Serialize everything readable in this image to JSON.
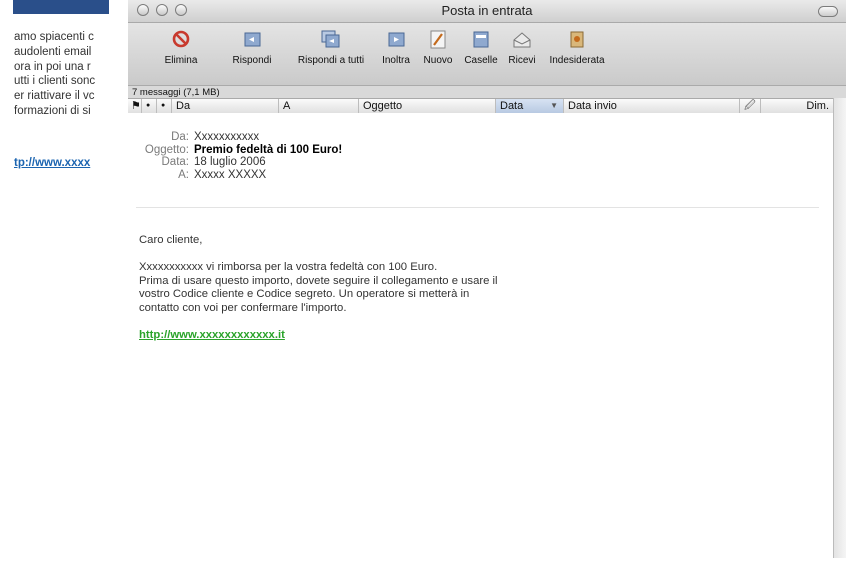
{
  "background_doc": {
    "lines": [
      "amo spiacenti c",
      "audolenti email",
      "ora in poi una r",
      "utti i clienti sonc",
      "er riattivare il vc",
      "formazioni di si"
    ],
    "link": "tp://www.xxxx"
  },
  "window": {
    "title": "Posta in entrata"
  },
  "toolbar": {
    "buttons": [
      {
        "label": "Elimina",
        "icon": "delete-icon"
      },
      {
        "label": "Rispondi",
        "icon": "reply-icon"
      },
      {
        "label": "Rispondi a tutti",
        "icon": "reply-all-icon"
      },
      {
        "label": "Inoltra",
        "icon": "forward-icon"
      },
      {
        "label": "Nuovo",
        "icon": "compose-icon"
      },
      {
        "label": "Caselle",
        "icon": "mailboxes-icon"
      },
      {
        "label": "Ricevi",
        "icon": "get-mail-icon"
      },
      {
        "label": "Indesiderata",
        "icon": "junk-icon"
      }
    ]
  },
  "status": "7 messaggi (7,1 MB)",
  "columns": {
    "flag": "⚑",
    "read": "●",
    "chat": "●",
    "from": "Da",
    "to": "A",
    "subject": "Oggetto",
    "date": "Data",
    "sort_arrow": "▼",
    "date_sent": "Data invio",
    "attachment": "🖉",
    "size": "Dim."
  },
  "message": {
    "from_label": "Da:",
    "from_value": "Xxxxxxxxxxx",
    "subject_label": "Oggetto:",
    "subject_value": "Premio fedeltà di 100 Euro!",
    "date_label": "Data:",
    "date_value": "18 luglio 2006",
    "to_label": "A:",
    "to_value": "Xxxxx XXXXX",
    "greeting": "Caro cliente,",
    "line1": "Xxxxxxxxxxx vi rimborsa per la vostra fedeltà con 100 Euro.",
    "line2": "Prima di usare questo importo, dovete seguire il collegamento e usare il",
    "line3": "vostro Codice cliente e Codice segreto. Un operatore si metterà in",
    "line4": "contatto con voi per confermare l'importo.",
    "link": "http://www.xxxxxxxxxxxx.it"
  },
  "colors": {
    "link_green": "#2aa32a",
    "bg_link_blue": "#1b64b0"
  }
}
